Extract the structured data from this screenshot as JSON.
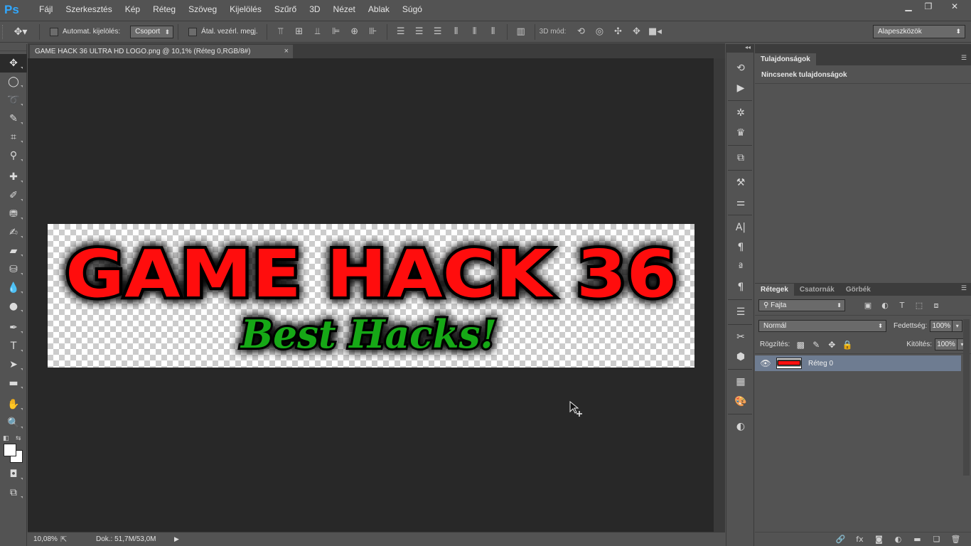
{
  "app": {
    "logo": "Ps"
  },
  "menu": [
    "Fájl",
    "Szerkesztés",
    "Kép",
    "Réteg",
    "Szöveg",
    "Kijelölés",
    "Szűrő",
    "3D",
    "Nézet",
    "Ablak",
    "Súgó"
  ],
  "window_controls": {
    "minimize": "▁",
    "restore": "❐",
    "close": "✕"
  },
  "options": {
    "auto_select_label": "Automat. kijelölés:",
    "auto_select_value": "Csoport",
    "transform_label": "Átal. vezérl. megj.",
    "mode_3d_label": "3D mód:",
    "workspace": "Alapeszközök"
  },
  "document": {
    "tab_title": "GAME HACK 36 ULTRA HD LOGO.png @ 10,1% (Réteg 0,RGB/8#)",
    "close_glyph": "×",
    "logo_main": "GAME HACK 36",
    "logo_sub": "Best Hacks!",
    "logo_main_color": "#ff0d0d",
    "logo_sub_color": "#14a814"
  },
  "status": {
    "zoom": "10,08%",
    "doc_size": "Dok.: 51,7M/53,0M"
  },
  "properties": {
    "tab": "Tulajdonságok",
    "empty_text": "Nincsenek tulajdonságok"
  },
  "layers_panel": {
    "tabs": [
      "Rétegek",
      "Csatornák",
      "Görbék"
    ],
    "filter_kind": "Fajta",
    "blend_mode": "Normál",
    "opacity_label": "Fedettség:",
    "opacity_value": "100%",
    "lock_label": "Rögzítés:",
    "fill_label": "Kitöltés:",
    "fill_value": "100%",
    "layers": [
      {
        "name": "Réteg 0",
        "visible": true,
        "selected": true
      }
    ]
  },
  "colors": {
    "foreground": "#ffffff",
    "background": "#ffffff",
    "selected_layer": "#6e7c91"
  }
}
